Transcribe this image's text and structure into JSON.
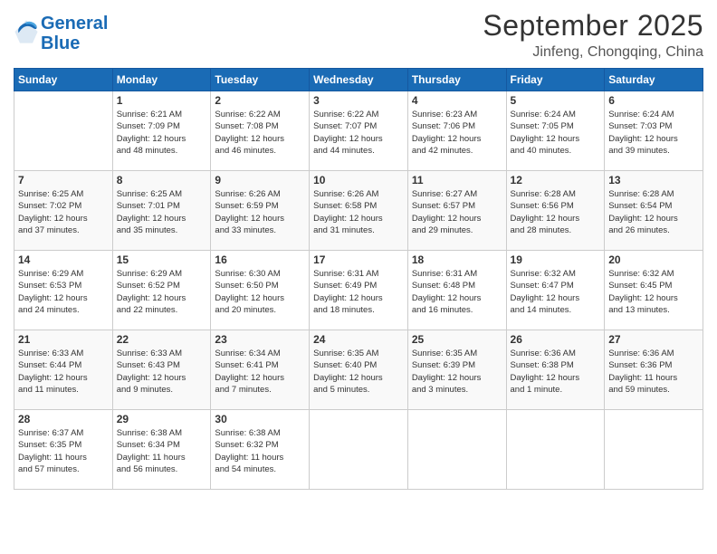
{
  "logo": {
    "line1": "General",
    "line2": "Blue"
  },
  "title": "September 2025",
  "location": "Jinfeng, Chongqing, China",
  "weekdays": [
    "Sunday",
    "Monday",
    "Tuesday",
    "Wednesday",
    "Thursday",
    "Friday",
    "Saturday"
  ],
  "weeks": [
    [
      {
        "day": "",
        "info": ""
      },
      {
        "day": "1",
        "info": "Sunrise: 6:21 AM\nSunset: 7:09 PM\nDaylight: 12 hours\nand 48 minutes."
      },
      {
        "day": "2",
        "info": "Sunrise: 6:22 AM\nSunset: 7:08 PM\nDaylight: 12 hours\nand 46 minutes."
      },
      {
        "day": "3",
        "info": "Sunrise: 6:22 AM\nSunset: 7:07 PM\nDaylight: 12 hours\nand 44 minutes."
      },
      {
        "day": "4",
        "info": "Sunrise: 6:23 AM\nSunset: 7:06 PM\nDaylight: 12 hours\nand 42 minutes."
      },
      {
        "day": "5",
        "info": "Sunrise: 6:24 AM\nSunset: 7:05 PM\nDaylight: 12 hours\nand 40 minutes."
      },
      {
        "day": "6",
        "info": "Sunrise: 6:24 AM\nSunset: 7:03 PM\nDaylight: 12 hours\nand 39 minutes."
      }
    ],
    [
      {
        "day": "7",
        "info": "Sunrise: 6:25 AM\nSunset: 7:02 PM\nDaylight: 12 hours\nand 37 minutes."
      },
      {
        "day": "8",
        "info": "Sunrise: 6:25 AM\nSunset: 7:01 PM\nDaylight: 12 hours\nand 35 minutes."
      },
      {
        "day": "9",
        "info": "Sunrise: 6:26 AM\nSunset: 6:59 PM\nDaylight: 12 hours\nand 33 minutes."
      },
      {
        "day": "10",
        "info": "Sunrise: 6:26 AM\nSunset: 6:58 PM\nDaylight: 12 hours\nand 31 minutes."
      },
      {
        "day": "11",
        "info": "Sunrise: 6:27 AM\nSunset: 6:57 PM\nDaylight: 12 hours\nand 29 minutes."
      },
      {
        "day": "12",
        "info": "Sunrise: 6:28 AM\nSunset: 6:56 PM\nDaylight: 12 hours\nand 28 minutes."
      },
      {
        "day": "13",
        "info": "Sunrise: 6:28 AM\nSunset: 6:54 PM\nDaylight: 12 hours\nand 26 minutes."
      }
    ],
    [
      {
        "day": "14",
        "info": "Sunrise: 6:29 AM\nSunset: 6:53 PM\nDaylight: 12 hours\nand 24 minutes."
      },
      {
        "day": "15",
        "info": "Sunrise: 6:29 AM\nSunset: 6:52 PM\nDaylight: 12 hours\nand 22 minutes."
      },
      {
        "day": "16",
        "info": "Sunrise: 6:30 AM\nSunset: 6:50 PM\nDaylight: 12 hours\nand 20 minutes."
      },
      {
        "day": "17",
        "info": "Sunrise: 6:31 AM\nSunset: 6:49 PM\nDaylight: 12 hours\nand 18 minutes."
      },
      {
        "day": "18",
        "info": "Sunrise: 6:31 AM\nSunset: 6:48 PM\nDaylight: 12 hours\nand 16 minutes."
      },
      {
        "day": "19",
        "info": "Sunrise: 6:32 AM\nSunset: 6:47 PM\nDaylight: 12 hours\nand 14 minutes."
      },
      {
        "day": "20",
        "info": "Sunrise: 6:32 AM\nSunset: 6:45 PM\nDaylight: 12 hours\nand 13 minutes."
      }
    ],
    [
      {
        "day": "21",
        "info": "Sunrise: 6:33 AM\nSunset: 6:44 PM\nDaylight: 12 hours\nand 11 minutes."
      },
      {
        "day": "22",
        "info": "Sunrise: 6:33 AM\nSunset: 6:43 PM\nDaylight: 12 hours\nand 9 minutes."
      },
      {
        "day": "23",
        "info": "Sunrise: 6:34 AM\nSunset: 6:41 PM\nDaylight: 12 hours\nand 7 minutes."
      },
      {
        "day": "24",
        "info": "Sunrise: 6:35 AM\nSunset: 6:40 PM\nDaylight: 12 hours\nand 5 minutes."
      },
      {
        "day": "25",
        "info": "Sunrise: 6:35 AM\nSunset: 6:39 PM\nDaylight: 12 hours\nand 3 minutes."
      },
      {
        "day": "26",
        "info": "Sunrise: 6:36 AM\nSunset: 6:38 PM\nDaylight: 12 hours\nand 1 minute."
      },
      {
        "day": "27",
        "info": "Sunrise: 6:36 AM\nSunset: 6:36 PM\nDaylight: 11 hours\nand 59 minutes."
      }
    ],
    [
      {
        "day": "28",
        "info": "Sunrise: 6:37 AM\nSunset: 6:35 PM\nDaylight: 11 hours\nand 57 minutes."
      },
      {
        "day": "29",
        "info": "Sunrise: 6:38 AM\nSunset: 6:34 PM\nDaylight: 11 hours\nand 56 minutes."
      },
      {
        "day": "30",
        "info": "Sunrise: 6:38 AM\nSunset: 6:32 PM\nDaylight: 11 hours\nand 54 minutes."
      },
      {
        "day": "",
        "info": ""
      },
      {
        "day": "",
        "info": ""
      },
      {
        "day": "",
        "info": ""
      },
      {
        "day": "",
        "info": ""
      }
    ]
  ]
}
